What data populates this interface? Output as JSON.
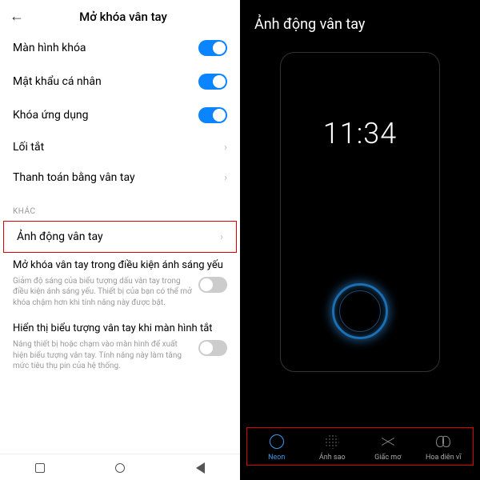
{
  "left": {
    "title": "Mở khóa vân tay",
    "rows": {
      "lockscreen": "Màn hình khóa",
      "password": "Mật khẩu cá nhân",
      "applock": "Khóa ứng dụng",
      "shortcut": "Lối tắt",
      "payment": "Thanh toán bằng vân tay"
    },
    "section_other": "KHÁC",
    "anim_row": "Ảnh động vân tay",
    "lowlight": {
      "title": "Mở khóa vân tay trong điều kiện ánh sáng yếu",
      "desc": "Giảm độ sáng của biểu tượng dấu vân tay trong điều kiện ánh sáng yếu. Thiết bị của bạn có thể mở khóa chậm hơn khi tính năng này được bật."
    },
    "showicon": {
      "title": "Hiển thị biểu tượng vân tay khi màn hình tắt",
      "desc": "Nâng thiết bị hoặc chạm vào màn hình để xuất hiện biểu tượng vân tay. Tính năng này làm tăng mức tiêu thụ pin của hệ thống."
    }
  },
  "right": {
    "title": "Ảnh động vân tay",
    "clock": "11:34",
    "effects": {
      "neon": "Neon",
      "star": "Ánh sao",
      "dream": "Giấc mơ",
      "butterfly": "Hoa diên vĩ"
    }
  }
}
